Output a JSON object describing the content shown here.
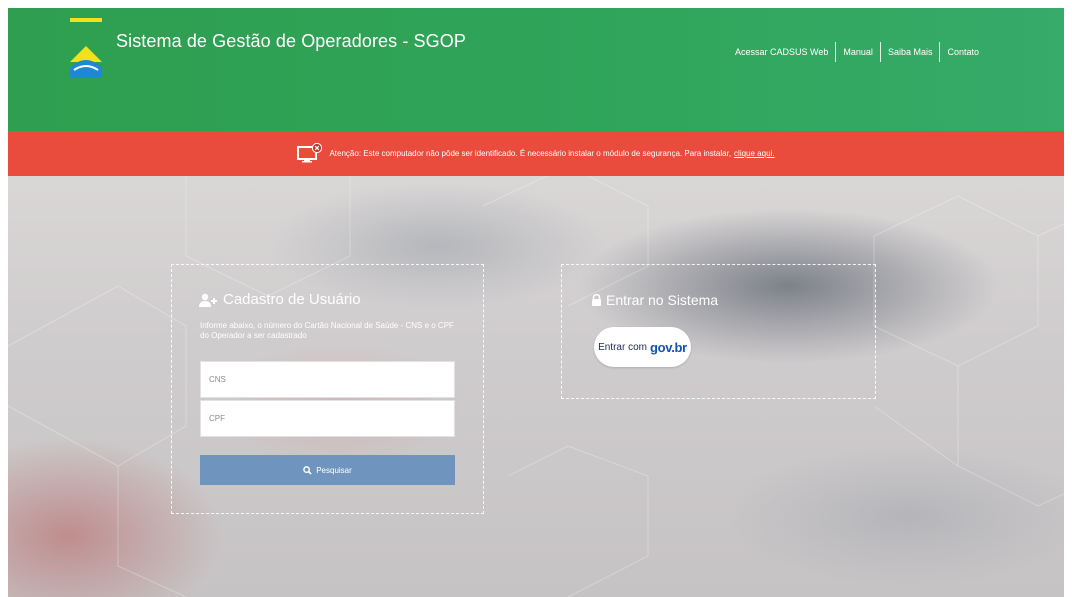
{
  "header": {
    "title": "Sistema de Gestão de Operadores - SGOP",
    "nav": [
      "Acessar CADSUS Web",
      "Manual",
      "Saiba Mais",
      "Contato"
    ]
  },
  "alert": {
    "text": "Atenção: Este computador não pôde ser identificado. É necessário instalar o módulo de segurança. Para instalar,",
    "link": "clique aqui."
  },
  "register": {
    "title": "Cadastro de Usuário",
    "description": "Informe abaixo, o número do Cartão Nacional de Saúde - CNS e o CPF do Operador a ser cadastrado",
    "cns_placeholder": "CNS",
    "cpf_placeholder": "CPF",
    "search_label": "Pesquisar"
  },
  "login": {
    "title": "Entrar no Sistema",
    "govbr_prefix": "Entrar com",
    "govbr_brand": "gov",
    "govbr_brand_suffix": ".br"
  },
  "colors": {
    "header_green": "#2f9e4f",
    "alert_red": "#e94b3c",
    "search_button": "#6f95bf",
    "govbr_blue": "#1351b4"
  },
  "icons": {
    "logo": "brazil-flag-logo-icon",
    "alert": "monitor-error-icon",
    "register": "user-plus-icon",
    "login": "lock-icon",
    "search": "search-icon"
  }
}
